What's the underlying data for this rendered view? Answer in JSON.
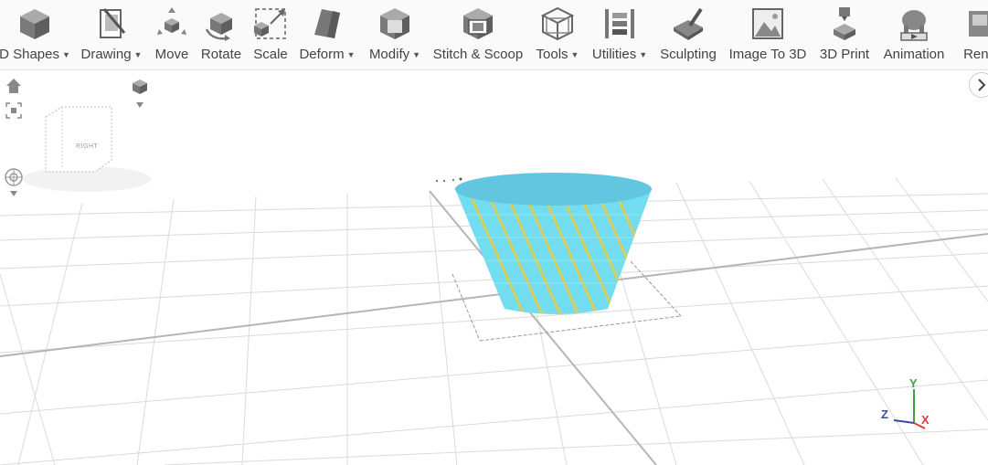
{
  "toolbar": {
    "items": [
      {
        "label": "D Shapes",
        "dropdown": true,
        "icon": "cube-icon"
      },
      {
        "label": "Drawing",
        "dropdown": true,
        "icon": "drawing-icon"
      },
      {
        "label": "Move",
        "dropdown": false,
        "icon": "move-icon"
      },
      {
        "label": "Rotate",
        "dropdown": false,
        "icon": "rotate-icon"
      },
      {
        "label": "Scale",
        "dropdown": false,
        "icon": "scale-icon"
      },
      {
        "label": "Deform",
        "dropdown": true,
        "icon": "deform-icon"
      },
      {
        "label": "Modify",
        "dropdown": true,
        "icon": "modify-icon"
      },
      {
        "label": "Stitch & Scoop",
        "dropdown": false,
        "icon": "stitch-scoop-icon"
      },
      {
        "label": "Tools",
        "dropdown": true,
        "icon": "tools-icon"
      },
      {
        "label": "Utilities",
        "dropdown": true,
        "icon": "utilities-icon"
      },
      {
        "label": "Sculpting",
        "dropdown": false,
        "icon": "sculpting-icon"
      },
      {
        "label": "Image To 3D",
        "dropdown": false,
        "icon": "image-to-3d-icon"
      },
      {
        "label": "3D Print",
        "dropdown": false,
        "icon": "3d-print-icon"
      },
      {
        "label": "Animation",
        "dropdown": false,
        "icon": "animation-icon"
      },
      {
        "label": "Rend",
        "dropdown": false,
        "icon": "render-icon"
      }
    ]
  },
  "view_cube": {
    "face_label": "RIGHT"
  },
  "axes": {
    "x": "X",
    "y": "Y",
    "z": "Z"
  },
  "colors": {
    "model": "#72dcf0",
    "model_top": "#63c6e0",
    "stripe": "#d8cf5a",
    "grid": "#dadada",
    "axis_x": "#e53935",
    "axis_y": "#43a047",
    "axis_z": "#3949ab"
  }
}
